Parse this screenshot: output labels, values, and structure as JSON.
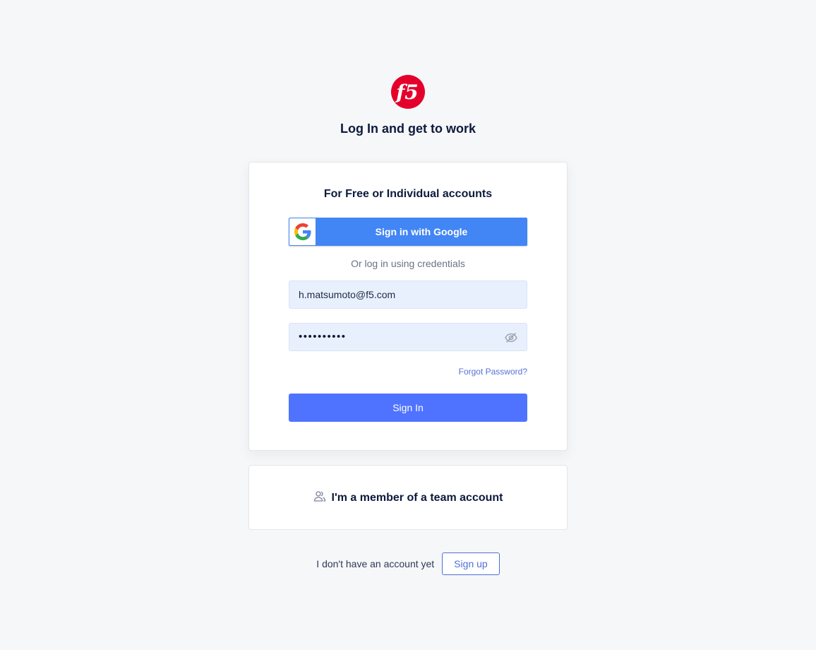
{
  "brand": {
    "logo_text": "f5",
    "logo_color": "#e4002b"
  },
  "headline": "Log In and get to work",
  "login_card": {
    "heading": "For Free or Individual accounts",
    "google_button": {
      "label": "Sign in with Google",
      "icon": "google-g-icon",
      "color": "#4285f4"
    },
    "divider_text": "Or log in using credentials",
    "email_field": {
      "value": "h.matsumoto@f5.com"
    },
    "password_field": {
      "masked_value": "••••••••••",
      "toggle_icon": "eye-slash-icon"
    },
    "forgot_link": "Forgot Password?",
    "submit_button": {
      "label": "Sign In",
      "color": "#4f73ff"
    }
  },
  "team_card": {
    "icon": "users-icon",
    "label": "I'm a member of a team account"
  },
  "signup": {
    "prompt": "I don't have an account yet",
    "button_label": "Sign up"
  }
}
